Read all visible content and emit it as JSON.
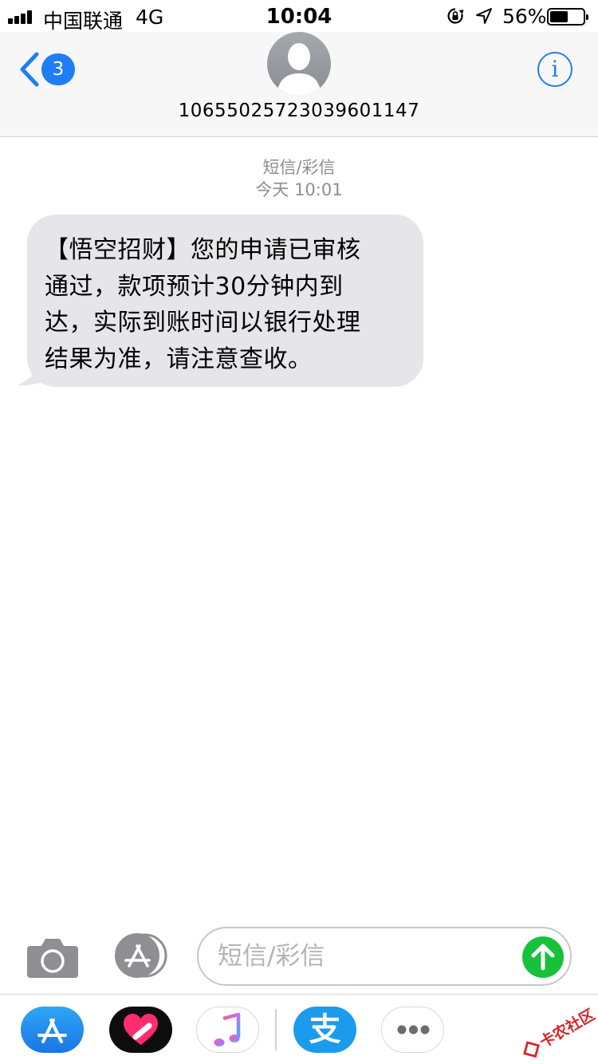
{
  "status_bar": {
    "carrier": "中国联通",
    "network": "4G",
    "time": "10:04",
    "battery_percent_text": "56%",
    "battery_level": 0.56,
    "icons": [
      "signal-bars-icon",
      "rotation-lock-icon",
      "location-arrow-icon",
      "battery-icon"
    ]
  },
  "header": {
    "back_badge_count": "3",
    "contact_number": "10655025723039601147",
    "info_label": "i",
    "accent_color": "#1f7ef5"
  },
  "thread": {
    "service_label": "短信/彩信",
    "timestamp": "今天 10:01",
    "messages": [
      {
        "direction": "incoming",
        "lines": [
          "【悟空招财】您的申请已审核",
          "通过，款项预计30分钟内到",
          "达，实际到账时间以银行处理",
          "结果为准，请注意查收。"
        ]
      }
    ]
  },
  "compose": {
    "placeholder": "短信/彩信",
    "value": "",
    "send_color": "#18c13a"
  },
  "app_drawer": {
    "apps": [
      "app-store-icon",
      "heart-app-icon",
      "music-icon",
      "alipay-icon",
      "more-icon"
    ],
    "alipay_glyph": "支",
    "watermark_text": "卡农社区"
  }
}
